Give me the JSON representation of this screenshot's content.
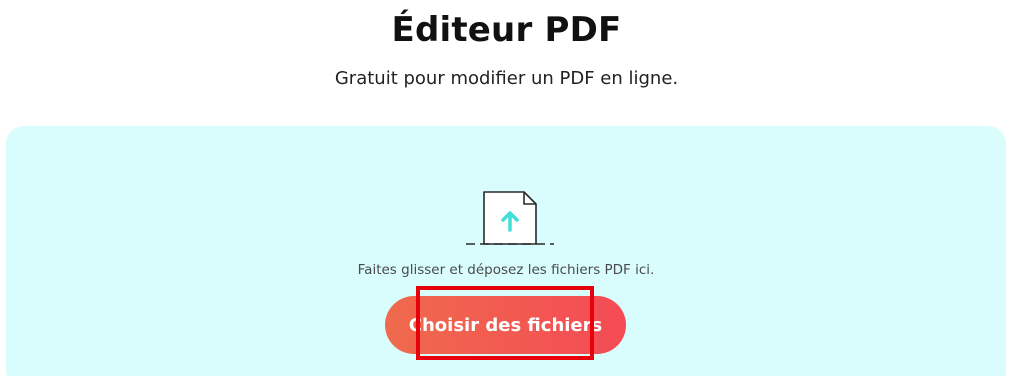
{
  "header": {
    "title": "Éditeur PDF",
    "subtitle": "Gratuit pour modifier un PDF en ligne."
  },
  "dropzone": {
    "hint": "Faites glisser et déposez les fichiers PDF ici.",
    "upload_icon": "file-upload-icon",
    "choose_button_label": "Choisir des fichiers"
  },
  "colors": {
    "dropzone_bg": "#d9fdfd",
    "button_gradient_start": "#ef6a4c",
    "button_gradient_end": "#f54b56",
    "arrow_accent": "#40e0d8",
    "highlight": "#e8000b"
  }
}
